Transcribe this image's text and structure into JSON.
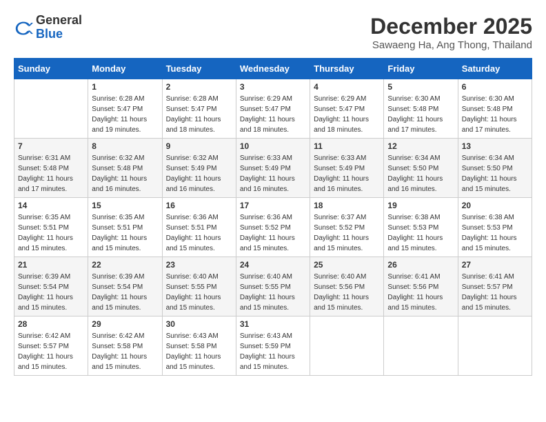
{
  "header": {
    "logo_general": "General",
    "logo_blue": "Blue",
    "title": "December 2025",
    "subtitle": "Sawaeng Ha, Ang Thong, Thailand"
  },
  "weekdays": [
    "Sunday",
    "Monday",
    "Tuesday",
    "Wednesday",
    "Thursday",
    "Friday",
    "Saturday"
  ],
  "weeks": [
    [
      {
        "day": "",
        "sunrise": "",
        "sunset": "",
        "daylight": ""
      },
      {
        "day": "1",
        "sunrise": "6:28 AM",
        "sunset": "5:47 PM",
        "daylight": "11 hours and 19 minutes."
      },
      {
        "day": "2",
        "sunrise": "6:28 AM",
        "sunset": "5:47 PM",
        "daylight": "11 hours and 18 minutes."
      },
      {
        "day": "3",
        "sunrise": "6:29 AM",
        "sunset": "5:47 PM",
        "daylight": "11 hours and 18 minutes."
      },
      {
        "day": "4",
        "sunrise": "6:29 AM",
        "sunset": "5:47 PM",
        "daylight": "11 hours and 18 minutes."
      },
      {
        "day": "5",
        "sunrise": "6:30 AM",
        "sunset": "5:48 PM",
        "daylight": "11 hours and 17 minutes."
      },
      {
        "day": "6",
        "sunrise": "6:30 AM",
        "sunset": "5:48 PM",
        "daylight": "11 hours and 17 minutes."
      }
    ],
    [
      {
        "day": "7",
        "sunrise": "6:31 AM",
        "sunset": "5:48 PM",
        "daylight": "11 hours and 17 minutes."
      },
      {
        "day": "8",
        "sunrise": "6:32 AM",
        "sunset": "5:48 PM",
        "daylight": "11 hours and 16 minutes."
      },
      {
        "day": "9",
        "sunrise": "6:32 AM",
        "sunset": "5:49 PM",
        "daylight": "11 hours and 16 minutes."
      },
      {
        "day": "10",
        "sunrise": "6:33 AM",
        "sunset": "5:49 PM",
        "daylight": "11 hours and 16 minutes."
      },
      {
        "day": "11",
        "sunrise": "6:33 AM",
        "sunset": "5:49 PM",
        "daylight": "11 hours and 16 minutes."
      },
      {
        "day": "12",
        "sunrise": "6:34 AM",
        "sunset": "5:50 PM",
        "daylight": "11 hours and 16 minutes."
      },
      {
        "day": "13",
        "sunrise": "6:34 AM",
        "sunset": "5:50 PM",
        "daylight": "11 hours and 15 minutes."
      }
    ],
    [
      {
        "day": "14",
        "sunrise": "6:35 AM",
        "sunset": "5:51 PM",
        "daylight": "11 hours and 15 minutes."
      },
      {
        "day": "15",
        "sunrise": "6:35 AM",
        "sunset": "5:51 PM",
        "daylight": "11 hours and 15 minutes."
      },
      {
        "day": "16",
        "sunrise": "6:36 AM",
        "sunset": "5:51 PM",
        "daylight": "11 hours and 15 minutes."
      },
      {
        "day": "17",
        "sunrise": "6:36 AM",
        "sunset": "5:52 PM",
        "daylight": "11 hours and 15 minutes."
      },
      {
        "day": "18",
        "sunrise": "6:37 AM",
        "sunset": "5:52 PM",
        "daylight": "11 hours and 15 minutes."
      },
      {
        "day": "19",
        "sunrise": "6:38 AM",
        "sunset": "5:53 PM",
        "daylight": "11 hours and 15 minutes."
      },
      {
        "day": "20",
        "sunrise": "6:38 AM",
        "sunset": "5:53 PM",
        "daylight": "11 hours and 15 minutes."
      }
    ],
    [
      {
        "day": "21",
        "sunrise": "6:39 AM",
        "sunset": "5:54 PM",
        "daylight": "11 hours and 15 minutes."
      },
      {
        "day": "22",
        "sunrise": "6:39 AM",
        "sunset": "5:54 PM",
        "daylight": "11 hours and 15 minutes."
      },
      {
        "day": "23",
        "sunrise": "6:40 AM",
        "sunset": "5:55 PM",
        "daylight": "11 hours and 15 minutes."
      },
      {
        "day": "24",
        "sunrise": "6:40 AM",
        "sunset": "5:55 PM",
        "daylight": "11 hours and 15 minutes."
      },
      {
        "day": "25",
        "sunrise": "6:40 AM",
        "sunset": "5:56 PM",
        "daylight": "11 hours and 15 minutes."
      },
      {
        "day": "26",
        "sunrise": "6:41 AM",
        "sunset": "5:56 PM",
        "daylight": "11 hours and 15 minutes."
      },
      {
        "day": "27",
        "sunrise": "6:41 AM",
        "sunset": "5:57 PM",
        "daylight": "11 hours and 15 minutes."
      }
    ],
    [
      {
        "day": "28",
        "sunrise": "6:42 AM",
        "sunset": "5:57 PM",
        "daylight": "11 hours and 15 minutes."
      },
      {
        "day": "29",
        "sunrise": "6:42 AM",
        "sunset": "5:58 PM",
        "daylight": "11 hours and 15 minutes."
      },
      {
        "day": "30",
        "sunrise": "6:43 AM",
        "sunset": "5:58 PM",
        "daylight": "11 hours and 15 minutes."
      },
      {
        "day": "31",
        "sunrise": "6:43 AM",
        "sunset": "5:59 PM",
        "daylight": "11 hours and 15 minutes."
      },
      {
        "day": "",
        "sunrise": "",
        "sunset": "",
        "daylight": ""
      },
      {
        "day": "",
        "sunrise": "",
        "sunset": "",
        "daylight": ""
      },
      {
        "day": "",
        "sunrise": "",
        "sunset": "",
        "daylight": ""
      }
    ]
  ],
  "labels": {
    "sunrise": "Sunrise:",
    "sunset": "Sunset:",
    "daylight": "Daylight:"
  }
}
